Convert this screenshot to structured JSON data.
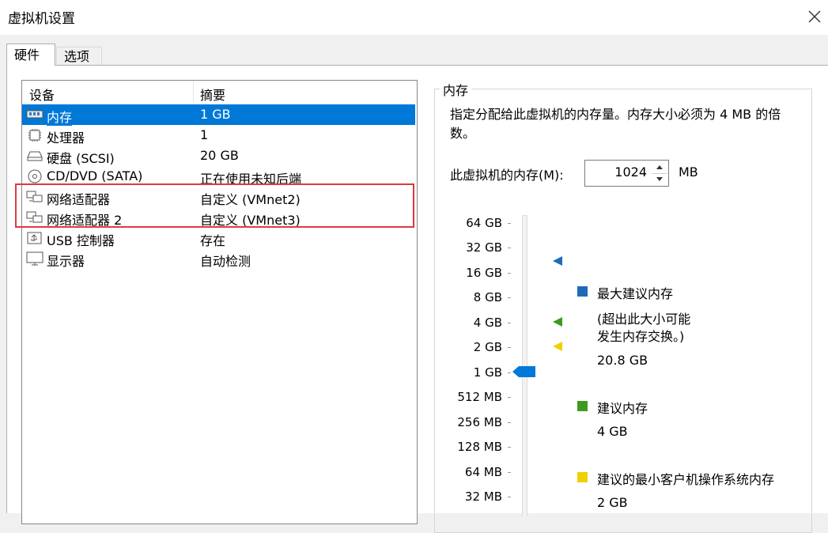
{
  "window": {
    "title": "虚拟机设置"
  },
  "tabs": [
    {
      "label": "硬件"
    },
    {
      "label": "选项"
    }
  ],
  "device_list": {
    "headers": {
      "device": "设备",
      "summary": "摘要"
    },
    "rows": [
      {
        "name": "内存",
        "summary": "1 GB",
        "icon": "memory-icon",
        "selected": true
      },
      {
        "name": "处理器",
        "summary": "1",
        "icon": "processor-icon"
      },
      {
        "name": "硬盘 (SCSI)",
        "summary": "20 GB",
        "icon": "harddisk-icon"
      },
      {
        "name": "CD/DVD (SATA)",
        "summary": "正在使用未知后端",
        "icon": "cd-icon"
      },
      {
        "name": "网络适配器",
        "summary": "自定义 (VMnet2)",
        "icon": "network-icon"
      },
      {
        "name": "网络适配器 2",
        "summary": "自定义 (VMnet3)",
        "icon": "network-icon"
      },
      {
        "name": "USB 控制器",
        "summary": "存在",
        "icon": "usb-icon"
      },
      {
        "name": "显示器",
        "summary": "自动检测",
        "icon": "monitor-icon"
      }
    ]
  },
  "memory": {
    "group_title": "内存",
    "description": "指定分配给此虚拟机的内存量。内存大小必须为 4 MB 的倍数。",
    "field_label": "此虚拟机的内存(M):",
    "value": "1024",
    "unit": "MB",
    "scale": [
      "64 GB",
      "32 GB",
      "16 GB",
      "8 GB",
      "4 GB",
      "2 GB",
      "1 GB",
      "512 MB",
      "256 MB",
      "128 MB",
      "64 MB",
      "32 MB"
    ],
    "current": "1 GB",
    "legend": {
      "max_label": "最大建议内存",
      "max_note_1": "(超出此大小可能",
      "max_note_2": "发生内存交换。)",
      "max_value": "20.8 GB",
      "rec_label": "建议内存",
      "rec_value": "4 GB",
      "min_label": "建议的最小客户机操作系统内存",
      "min_value": "2 GB"
    },
    "colors": {
      "max": "#1e6bb8",
      "recommended": "#3c9a1f",
      "minimum": "#f0d000",
      "slider": "#0078d7"
    }
  }
}
